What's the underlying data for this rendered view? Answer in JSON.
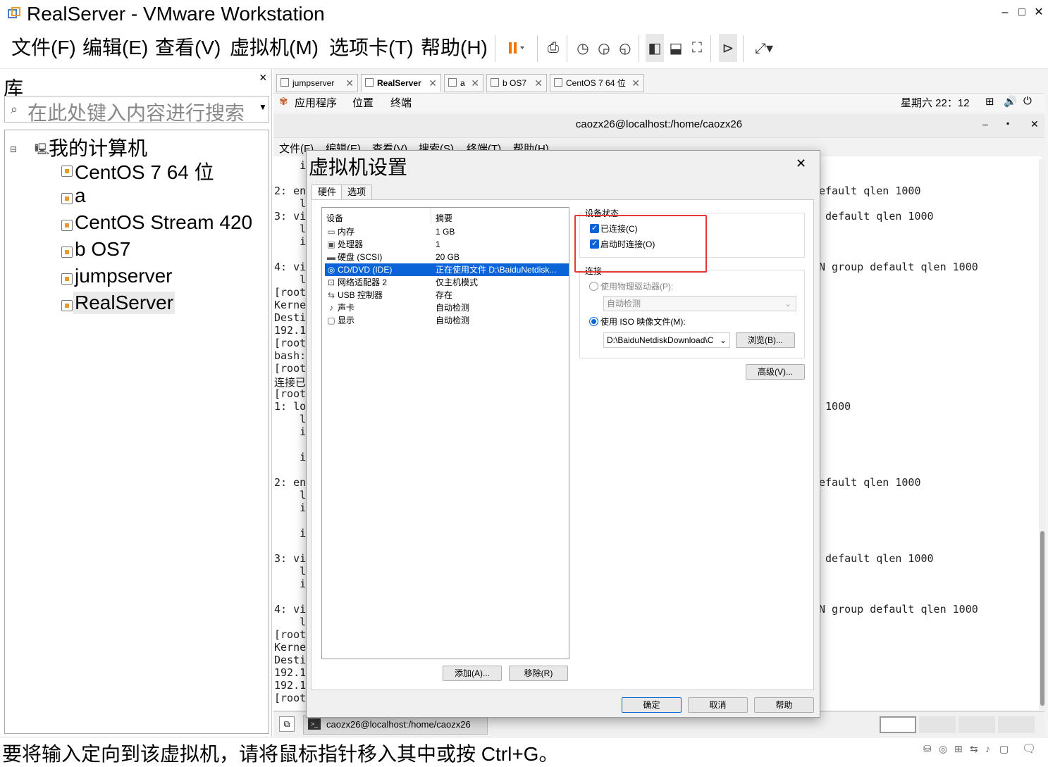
{
  "window": {
    "title": "RealServer - VMware Workstation",
    "minimize": "–",
    "maximize": "□",
    "close": "✕"
  },
  "menubar": {
    "items": [
      "文件(F)",
      "编辑(E)",
      "查看(V)",
      "虚拟机(M)",
      "选项卡(T)",
      "帮助(H)"
    ]
  },
  "library": {
    "title": "库",
    "close": "×",
    "search_placeholder": "在此处键入内容进行搜索",
    "root": "我的计算机",
    "vms": [
      "CentOS 7 64 位",
      "a",
      "CentOS Stream 420",
      "b OS7",
      "jumpserver",
      "RealServer"
    ],
    "selected_vm": "RealServer"
  },
  "tabs": [
    {
      "label": "jumpserver",
      "close": "✕"
    },
    {
      "label": "RealServer",
      "close": "✕",
      "active": true
    },
    {
      "label": "a",
      "close": "✕"
    },
    {
      "label": "b OS7",
      "close": "✕"
    },
    {
      "label": "CentOS 7 64 位",
      "close": "✕"
    }
  ],
  "guest": {
    "topbar": {
      "apps": "应用程序",
      "places": "位置",
      "terminal": "终端",
      "clock": "星期六 22：12"
    },
    "terminal": {
      "title": "caozx26@localhost:/home/caozx26",
      "menu": [
        "文件(F)",
        "编辑(E)",
        "查看(V)",
        "搜索(S)",
        "终端(T)",
        "帮助(H)"
      ],
      "left_lines": [
        "    i",
        "",
        "2: en",
        "    l",
        "3: vi",
        "    l",
        "    i",
        "",
        "4: vi",
        "    l",
        "[root",
        "Kerne",
        "Desti",
        "192.1",
        "[root",
        "bash:",
        "[root",
        "连接已",
        "[root",
        "1: lo",
        "    l",
        "    i",
        "",
        "    i",
        "",
        "2: en",
        "    l",
        "    i",
        "",
        "    i",
        "",
        "3: vi",
        "    l",
        "    i",
        "",
        "4: vi",
        "    l",
        "[root",
        "Kerne",
        "Desti",
        "192.1",
        "192.1",
        "[root"
      ],
      "right_lines": [
        {
          "row": 2,
          "text": "efault qlen 1000"
        },
        {
          "row": 4,
          "text": " default qlen 1000"
        },
        {
          "row": 8,
          "text": "N group default qlen 1000"
        },
        {
          "row": 19,
          "text": " 1000"
        },
        {
          "row": 25,
          "text": "efault qlen 1000"
        },
        {
          "row": 31,
          "text": " default qlen 1000"
        },
        {
          "row": 35,
          "text": "N group default qlen 1000"
        }
      ]
    },
    "taskbar_item": "caozx26@localhost:/home/caozx26"
  },
  "dialog": {
    "title": "虚拟机设置",
    "close": "✕",
    "tabs": [
      "硬件",
      "选项"
    ],
    "device_header": "设备",
    "summary_header": "摘要",
    "devices": [
      {
        "icon": "▭",
        "name": "内存",
        "summary": "1 GB"
      },
      {
        "icon": "▣",
        "name": "处理器",
        "summary": "1"
      },
      {
        "icon": "▬",
        "name": "硬盘 (SCSI)",
        "summary": "20 GB"
      },
      {
        "icon": "◎",
        "name": "CD/DVD (IDE)",
        "summary": "正在使用文件 D:\\BaiduNetdisk...",
        "selected": true
      },
      {
        "icon": "⊡",
        "name": "网络适配器 2",
        "summary": "仅主机模式"
      },
      {
        "icon": "⇆",
        "name": "USB 控制器",
        "summary": "存在"
      },
      {
        "icon": "♪",
        "name": "声卡",
        "summary": "自动检测"
      },
      {
        "icon": "▢",
        "name": "显示",
        "summary": "自动检测"
      }
    ],
    "add_button": "添加(A)...",
    "remove_button": "移除(R)",
    "device_status_label": "设备状态",
    "connected": "已连接(C)",
    "connect_at_power_on": "启动时连接(O)",
    "connection_label": "连接",
    "use_physical_drive": "使用物理驱动器(P):",
    "auto_detect": "自动检测",
    "use_iso": "使用 ISO 映像文件(M):",
    "iso_path": "D:\\BaiduNetdiskDownload\\C",
    "browse_button": "浏览(B)...",
    "advanced_button": "高级(V)...",
    "ok_button": "确定",
    "cancel_button": "取消",
    "help_button": "帮助"
  },
  "statusbar": {
    "message": "要将输入定向到该虚拟机，请将鼠标指针移入其中或按 Ctrl+G。"
  },
  "colors": {
    "accent": "#0a64d8",
    "highlight_box": "#e53935",
    "pause_icon": "#f07800"
  }
}
